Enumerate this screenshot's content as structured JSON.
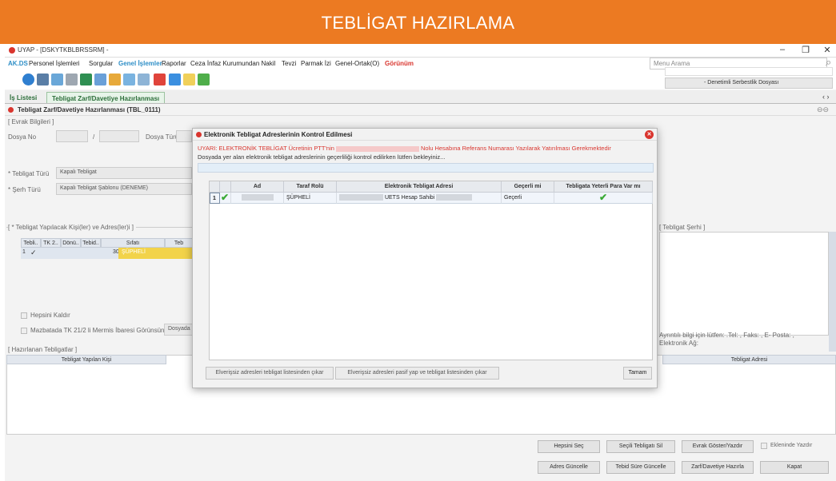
{
  "banner": {
    "title": "TEBLİGAT HAZIRLAMA"
  },
  "window": {
    "title": "UYAP - [DSKYTKBLBRSSRM] -",
    "minimize": "–",
    "maximize": "❐",
    "close": "✕"
  },
  "menu": {
    "items": [
      "AK.DS",
      "Personel İşlemleri",
      "Sorgular",
      "Genel İşlemler",
      "Raporlar",
      "Ceza İnfaz Kurumundan Nakil",
      "Tevzi",
      "Parmak İzi",
      "Genel-Ortak(O)",
      "Görünüm"
    ],
    "search_placeholder": "Menu Arama"
  },
  "dosya_selector": "- Denetimli Serbestlik Dosyası",
  "tabs": [
    {
      "label": "İş Listesi"
    },
    {
      "label": "Tebligat Zarf/Davetiye Hazırlanması"
    }
  ],
  "page_header": "Tebligat Zarf/Davetiye Hazırlanması (TBL_0111)",
  "background": {
    "evrak_bilgileri": "[ Evrak Bilgileri ]",
    "dosya_no": "Dosya No",
    "dosya_no_sep": "/",
    "dosya_turu": "Dosya Türü",
    "tebligat_turu": "* Tebligat Türü",
    "tebligat_turu_value": "Kapalı Tebligat",
    "sekil_turu": "* Şerh Türü",
    "sekil_turu_value": "Kapalı Tebligat Şablonu (DENEME)",
    "yapilacak_kisiler": "[ * Tebligat Yapılacak Kişi(ler) ve Adres(ler)i ]",
    "grid_cols": [
      "Tebli..",
      "TK 2..",
      "Dönü..",
      "Tebid..",
      "Sıfatı",
      "Teb"
    ],
    "grid_row": {
      "num": "1",
      "check": "✓",
      "tebid": "30",
      "sifat": "ŞÜPHELİ"
    },
    "hepsini_kaldir": "Hepsini Kaldır",
    "mazbatada": "Mazbatada TK 21/2 li Mermis İbaresi Görünsün",
    "dosyada": "Dosyada",
    "tebligat_serhi": "[ Tebligat Şerhi ]",
    "aciklama": "Ayrıntılı bilgi için lütfen: .Tel: , Faks: , E- Posta: , Elektronik Ağ:",
    "hazirlanan": "[ Hazırlanan Tebligatlar ]",
    "tebligat_yapilan_kisi": "Tebligat Yapılan Kişi",
    "tebligat_adresi": "Tebligat Adresi"
  },
  "bottom_buttons": {
    "row1": [
      "Hepsini Seç",
      "Seçili Tebligatı Sil",
      "Evrak Göster/Yazdır"
    ],
    "ekraninda_yazdir": "Ekleninde Yazdır",
    "row2": [
      "Adres Güncelle",
      "Tebid Süre Güncelle",
      "Zarf/Davetiye Hazırla",
      "Kapat"
    ]
  },
  "modal": {
    "title": "Elektronik Tebligat Adreslerinin Kontrol Edilmesi",
    "warning_prefix": "UYARI: ELEKTRONİK TEBLİGAT Ücretinin PTT'nin",
    "warning_suffix": "Nolu Hesabına Referans Numarası Yazılarak Yatırılması Gerekmektedir",
    "info": "Dosyada yer alan elektronik tebligat adreslerinin geçerliliği kontrol edilirken lütfen bekleyiniz...",
    "columns": [
      "Ad",
      "Taraf Rolü",
      "Elektronik Tebligat Adresi",
      "Geçerli mi",
      "Tebligata Yeterli Para Var mı"
    ],
    "rows": [
      {
        "num": "1",
        "ad": "",
        "rol": "ŞÜPHELİ",
        "adres": "UETS Hesap Sahibi",
        "gecerli": "Geçerli"
      }
    ],
    "btn_cikar": "Elverişsiz adresleri tebligat listesinden çıkar",
    "btn_pasif": "Elverişsiz adresleri pasif yap ve tebligat listesinden çıkar",
    "btn_tamam": "Tamam"
  }
}
